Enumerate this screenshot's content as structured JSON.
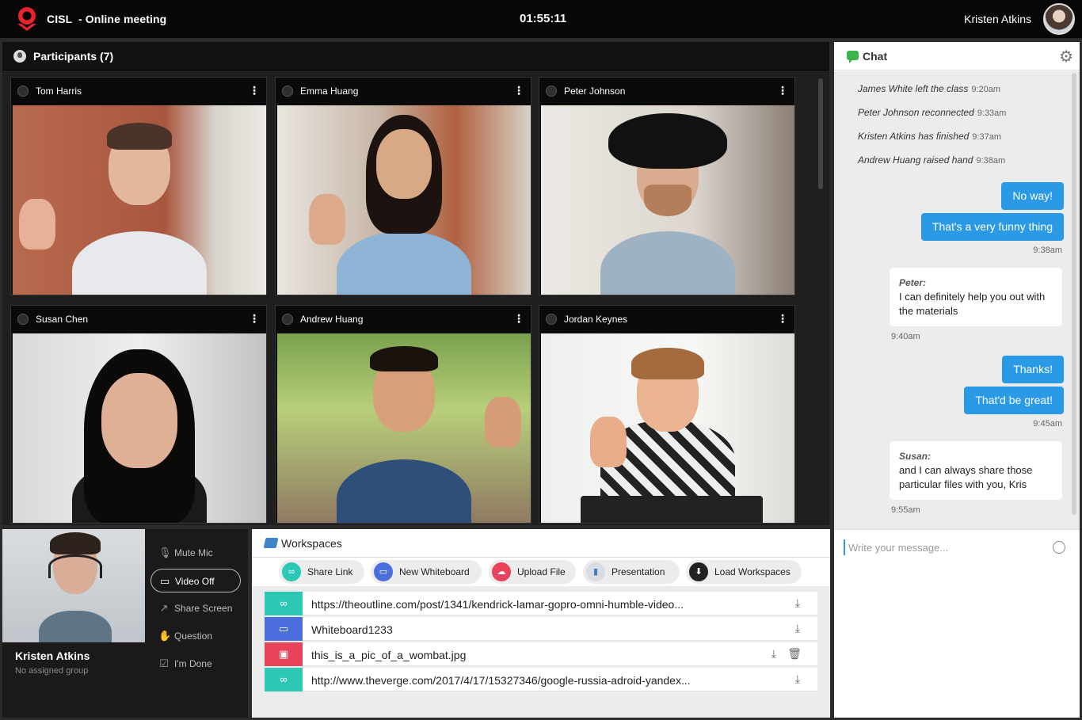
{
  "app": {
    "brand": "CISL",
    "subtitle": "- Online meeting",
    "timer": "01:55:11",
    "user_name": "Kristen Atkins"
  },
  "participants": {
    "title": "Participants (7)",
    "tiles": [
      {
        "name": "Tom Harris"
      },
      {
        "name": "Emma Huang"
      },
      {
        "name": "Peter Johnson"
      },
      {
        "name": "Susan Chen"
      },
      {
        "name": "Andrew Huang"
      },
      {
        "name": "Jordan Keynes"
      }
    ]
  },
  "self": {
    "name": "Kristen Atkins",
    "group": "No assigned group",
    "controls": [
      {
        "label": "Mute Mic",
        "icon": "microphone-icon",
        "active": false
      },
      {
        "label": "Video Off",
        "icon": "video-camera-icon",
        "active": true
      },
      {
        "label": "Share Screen",
        "icon": "share-icon",
        "active": false
      },
      {
        "label": "Question",
        "icon": "raise-hand-icon",
        "active": false
      },
      {
        "label": "I'm Done",
        "icon": "checkbox-icon",
        "active": false
      }
    ]
  },
  "workspaces": {
    "title": "Workspaces",
    "buttons": [
      {
        "label": "Share Link",
        "icon": "link-icon",
        "color": "#2dc7b5"
      },
      {
        "label": "New Whiteboard",
        "icon": "whiteboard-icon",
        "color": "#4a6fdc"
      },
      {
        "label": "Upload File",
        "icon": "upload-cloud-icon",
        "color": "#e8435a"
      },
      {
        "label": "Presentation",
        "icon": "presentation-chart-icon",
        "color": "#e0e0e0"
      },
      {
        "label": "Load Workspaces",
        "icon": "download-icon",
        "color": "#222222"
      }
    ],
    "items": [
      {
        "text": "https://theoutline.com/post/1341/kendrick-lamar-gopro-omni-humble-video...",
        "icon": "link-icon",
        "color": "#2dc7b5",
        "deletable": false
      },
      {
        "text": "Whiteboard1233",
        "icon": "whiteboard-icon",
        "color": "#4a6fdc",
        "deletable": false
      },
      {
        "text": "this_is_a_pic_of_a_wombat.jpg",
        "icon": "image-icon",
        "color": "#e8435a",
        "deletable": true
      },
      {
        "text": "http://www.theverge.com/2017/4/17/15327346/google-russia-adroid-yandex...",
        "icon": "link-icon",
        "color": "#2dc7b5",
        "deletable": false
      }
    ]
  },
  "chat": {
    "title": "Chat",
    "system_messages": [
      {
        "text": "James White left the class",
        "time": "9:20am"
      },
      {
        "text": "Peter Johnson reconnected",
        "time": "9:33am"
      },
      {
        "text": "Kristen Atkins has finished",
        "time": "9:37am"
      },
      {
        "text": "Andrew Huang raised hand",
        "time": "9:38am"
      }
    ],
    "out1": "No way!",
    "out2": "That's a very funny  thing",
    "out_time1": "9:38am",
    "in1_from": "Peter:",
    "in1_text": "I can definitely help you out with the materials",
    "in1_time": "9:40am",
    "out3": "Thanks!",
    "out4": "That'd be great!",
    "out_time2": "9:45am",
    "in2_from": "Susan:",
    "in2_text": "and I can always share those particular files with you, Kris",
    "in2_time": "9:55am",
    "input_placeholder": "Write your message..."
  }
}
